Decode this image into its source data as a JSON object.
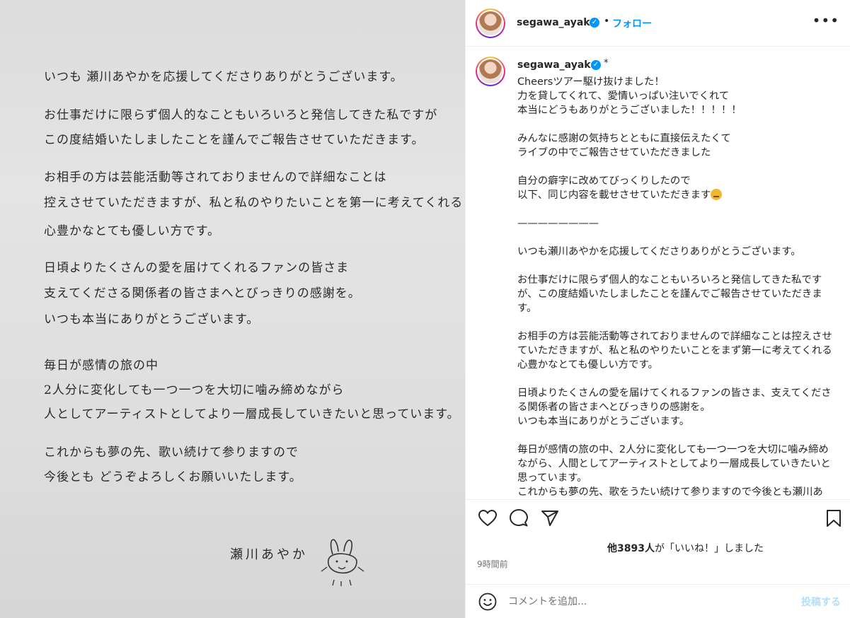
{
  "photo": {
    "lines": [
      "いつも 瀬川あやかを応援してくださりありがとうございます。",
      "お仕事だけに限らず個人的なこともいろいろと発信してきた私ですが",
      "この度結婚いたしましたことを謹んでご報告させていただきます。",
      "お相手の方は芸能活動等されておりませんので詳細なことは",
      "控えさせていただきますが、私と私のやりたいことを第一に考えてくれる",
      "心豊かなとても優しい方です。",
      "日頃よりたくさんの愛を届けてくれるファンの皆さま",
      "支えてくださる関係者の皆さまへとびっきりの感謝を。",
      "いつも本当にありがとうございます。",
      "毎日が感情の旅の中",
      "2人分に変化しても一つ一つを大切に噛み締めながら",
      "人としてアーティストとしてより一層成長していきたいと思っています。",
      "これからも夢の先、歌い続けて参りますので",
      "今後とも どうぞよろしくお願いいたします。"
    ],
    "signature": "瀬川あやか"
  },
  "header": {
    "username": "segawa_ayaka",
    "dot": "•",
    "follow_label": "フォロー",
    "more": "•••"
  },
  "caption": {
    "username": "segawa_ayaka",
    "asterisk": "*",
    "lines_before_emoji": "Cheersツアー駆け抜けました！\n力を貸してくれて、愛情いっぱい注いでくれて\n本当にどうもありがとうございました！！！！！\n\nみんなに感謝の気持ちとともに直接伝えたくて\nライブの中でご報告させていただきました\n\n自分の癖字に改めてびっくりしたので\n以下、同じ内容を載せさせていただきます",
    "lines_after_emoji": "\n\n————————\n\nいつも瀬川あやかを応援してくださりありがとうございます。\n\nお仕事だけに限らず個人的なこともいろいろと発信してきた私ですが、この度結婚いたしましたことを謹んでご報告させていただきます。\n\nお相手の方は芸能活動等されておりませんので詳細なことは控えさせていただきますが、私と私のやりたいことをまず第一に考えてくれる心豊かなとても優しい方です。\n\n日頃よりたくさんの愛を届けてくれるファンの皆さま、支えてくださる関係者の皆さまへとびっきりの感謝を。\nいつも本当にありがとうございます。\n\n毎日が感情の旅の中、2人分に変化しても一つ一つを大切に噛み締めながら、人間としてアーティストとしてより一層成長していきたいと思っています。\nこれからも夢の先、歌をうたい続けて参りますので今後とも瀬川あやかをどうぞよろしくお願いいたします。"
  },
  "likes": {
    "prefix": "他",
    "count": "3893人",
    "suffix": "が「いいね！」しました"
  },
  "time": "9時間前",
  "comment": {
    "placeholder": "コメントを追加...",
    "post_label": "投稿する"
  },
  "colors": {
    "accent": "#0095f6",
    "post_disabled": "#b2dffc",
    "muted": "#737373"
  },
  "icons": [
    "heart-icon",
    "comment-icon",
    "share-icon",
    "bookmark-icon",
    "emoji-icon",
    "verified-icon"
  ]
}
